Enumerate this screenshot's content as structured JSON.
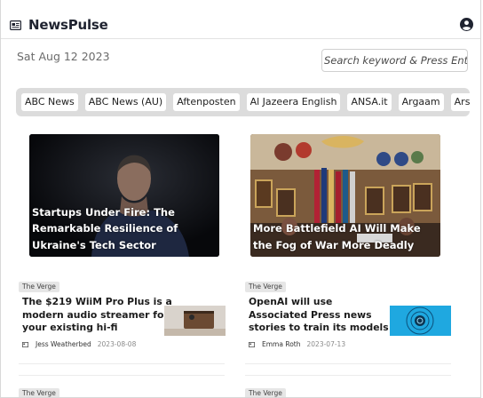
{
  "header": {
    "title": "NewsPulse",
    "logo_icon": "newspaper-icon",
    "user_icon": "account-circle-icon"
  },
  "date": "Sat Aug 12 2023",
  "search": {
    "placeholder": "Search keyword & Press Enter..."
  },
  "sources": [
    "ABC News",
    "ABC News (AU)",
    "Aftenposten",
    "Al Jazeera English",
    "ANSA.it",
    "Argaam",
    "Ars Technica"
  ],
  "hero_articles": [
    {
      "title": "Startups Under Fire: The Remarkable Resilience of Ukraine's Tech Sector"
    },
    {
      "title": "More Battlefield AI Will Make the Fog of War More Deadly"
    }
  ],
  "articles": [
    {
      "source": "The Verge",
      "title": "The $219 WiiM Pro Plus is a modern audio streamer for your existing hi-fi",
      "author": "Jess Weatherbed",
      "date": "2023-08-08"
    },
    {
      "source": "The Verge",
      "title": "OpenAI will use Associated Press news stories to train its models",
      "author": "Emma Roth",
      "date": "2023-07-13"
    }
  ],
  "more_articles": [
    {
      "source": "The Verge"
    },
    {
      "source": "The Verge"
    }
  ],
  "colors": {
    "accent_dark": "#1f2330",
    "chip_bar": "#dcdcdc",
    "badge": "#e6e6e6",
    "thumb_blue": "#1fa8e0"
  }
}
